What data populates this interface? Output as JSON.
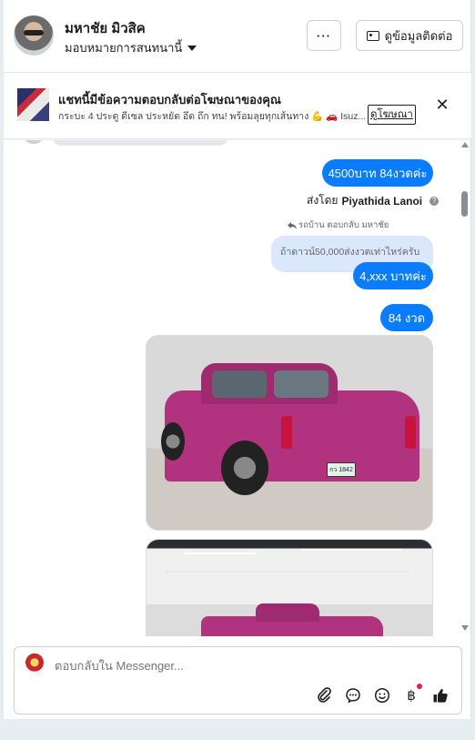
{
  "header": {
    "user_name": "มหาชัย มิวสิค",
    "assign_label": "มอบหมายการสนทนานี้",
    "more_label": "···",
    "contact_label": "ดูข้อมูลติดต่อ"
  },
  "ad_banner": {
    "title": "แชทนี้มีข้อความตอบกลับต่อโฆษณาของคุณ",
    "description": "กระบะ 4 ประตู ดีเซล ประหยัด อึด ถึก ทน! พร้อมลุยทุกเส้นทาง 💪 🚗 Isuz...",
    "link_label": "ดูโฆษณา",
    "close_label": "✕"
  },
  "messages": {
    "m1": "4500บาท 84งวดค่ะ",
    "sent_by_prefix": "ส่งโดย",
    "sent_by_name": "Piyathida Lanoi",
    "reply_meta": "รถบ้าน ตอบกลับ มหาชัย",
    "reply_quote": "ถ้าดาวน์50,000ส่งงวดเท่าไหร่ครับ",
    "m2": "4,xxx บาทค่ะ",
    "m3": "84 งวด"
  },
  "composer": {
    "placeholder": "ตอบกลับใน Messenger..."
  },
  "icons": {
    "attach": "paperclip-icon",
    "message": "chat-bubble-icon",
    "emoji": "smiley-icon",
    "payment": "baht-icon",
    "like": "thumbs-up-icon"
  },
  "colors": {
    "bubble": "#0a7cff",
    "quote_bubble": "#dbe8fb",
    "truck": "#b1327e"
  }
}
